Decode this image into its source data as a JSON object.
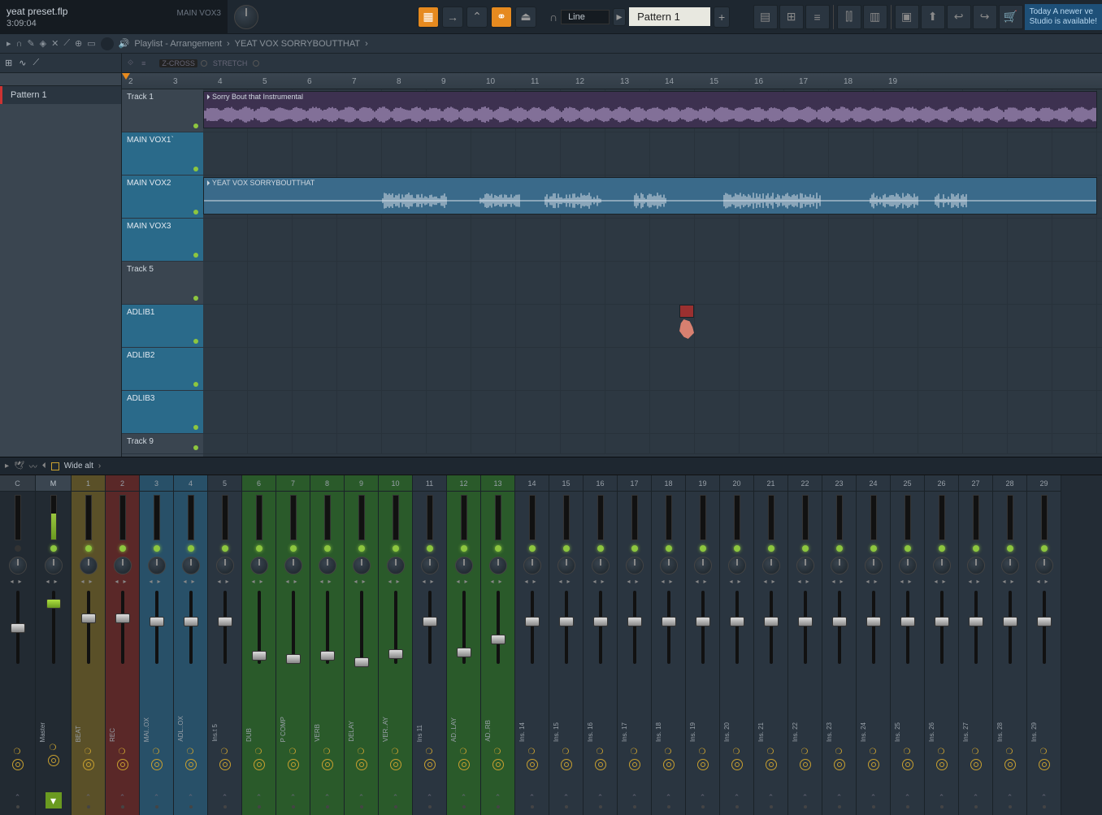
{
  "project": {
    "name": "yeat preset.flp",
    "time": "3:09:04",
    "channel": "MAIN VOX3"
  },
  "toolbar": {
    "snap_label": "Line",
    "pattern_label": "Pattern 1"
  },
  "update": {
    "today": "Today",
    "msg": "A newer ve",
    "msg2": "Studio is available!"
  },
  "breadcrumb": {
    "a": "Playlist - Arrangement",
    "b": "YEAT VOX SORRYBOUTTHAT"
  },
  "playlist_toolbar": {
    "zcross": "Z-CROSS",
    "stretch": "STRETCH"
  },
  "left_panel": {
    "pattern1": "Pattern 1"
  },
  "ruler_start": 2,
  "ruler_count": 18,
  "tracks": [
    {
      "label": "Track 1",
      "blue": false
    },
    {
      "label": "MAIN VOX1`",
      "blue": true
    },
    {
      "label": "MAIN VOX2",
      "blue": true
    },
    {
      "label": "MAIN VOX3",
      "blue": true
    },
    {
      "label": "Track 5",
      "blue": false
    },
    {
      "label": "ADLIB1",
      "blue": true
    },
    {
      "label": "ADLIB2",
      "blue": true
    },
    {
      "label": "ADLIB3",
      "blue": true
    },
    {
      "label": "Track 9",
      "blue": false
    }
  ],
  "clips": {
    "clip1": "Sorry Bout that Instrumental",
    "clip2": "YEAT VOX SORRYBOUTTHAT"
  },
  "mixer": {
    "layout": "Wide alt",
    "cols": [
      {
        "num": "C",
        "cls": "master-sec",
        "label": "",
        "led": false,
        "fader": 40
      },
      {
        "num": "M",
        "cls": "master-sec",
        "label": "Master",
        "led": true,
        "fader": 10,
        "master": true
      },
      {
        "num": "1",
        "cls": "yellow",
        "label": "BEAT",
        "led": true,
        "fader": 28
      },
      {
        "num": "2",
        "cls": "red",
        "label": "REC",
        "led": true,
        "fader": 28
      },
      {
        "num": "3",
        "cls": "blue",
        "label": "MAI..OX",
        "led": true,
        "fader": 32
      },
      {
        "num": "4",
        "cls": "blue",
        "label": "ADL..OX",
        "led": true,
        "fader": 32
      },
      {
        "num": "5",
        "cls": "",
        "label": "Ins.t 5",
        "led": true,
        "fader": 32
      },
      {
        "num": "6",
        "cls": "green",
        "label": "DUB",
        "led": true,
        "fader": 74
      },
      {
        "num": "7",
        "cls": "green",
        "label": "P COMP",
        "led": true,
        "fader": 78
      },
      {
        "num": "8",
        "cls": "green",
        "label": "VERB",
        "led": true,
        "fader": 74
      },
      {
        "num": "9",
        "cls": "green",
        "label": "DELAY",
        "led": true,
        "fader": 82
      },
      {
        "num": "10",
        "cls": "green",
        "label": "VER..AY",
        "led": true,
        "fader": 72
      },
      {
        "num": "11",
        "cls": "",
        "label": "Ins 11",
        "led": true,
        "fader": 32
      },
      {
        "num": "12",
        "cls": "green",
        "label": "AD..LAY",
        "led": true,
        "fader": 70
      },
      {
        "num": "13",
        "cls": "green",
        "label": "AD..RB",
        "led": true,
        "fader": 54
      },
      {
        "num": "14",
        "cls": "",
        "label": "Ins. 14",
        "led": true,
        "fader": 32
      },
      {
        "num": "15",
        "cls": "",
        "label": "Ins. 15",
        "led": true,
        "fader": 32
      },
      {
        "num": "16",
        "cls": "",
        "label": "Ins. 16",
        "led": true,
        "fader": 32
      },
      {
        "num": "17",
        "cls": "",
        "label": "Ins. 17",
        "led": true,
        "fader": 32
      },
      {
        "num": "18",
        "cls": "",
        "label": "Ins. 18",
        "led": true,
        "fader": 32
      },
      {
        "num": "19",
        "cls": "",
        "label": "Ins. 19",
        "led": true,
        "fader": 32
      },
      {
        "num": "20",
        "cls": "",
        "label": "Ins. 20",
        "led": true,
        "fader": 32
      },
      {
        "num": "21",
        "cls": "",
        "label": "Ins. 21",
        "led": true,
        "fader": 32
      },
      {
        "num": "22",
        "cls": "",
        "label": "Ins. 22",
        "led": true,
        "fader": 32
      },
      {
        "num": "23",
        "cls": "",
        "label": "Ins. 23",
        "led": true,
        "fader": 32
      },
      {
        "num": "24",
        "cls": "",
        "label": "Ins. 24",
        "led": true,
        "fader": 32
      },
      {
        "num": "25",
        "cls": "",
        "label": "Ins. 25",
        "led": true,
        "fader": 32
      },
      {
        "num": "26",
        "cls": "",
        "label": "Ins. 26",
        "led": true,
        "fader": 32
      },
      {
        "num": "27",
        "cls": "",
        "label": "Ins. 27",
        "led": true,
        "fader": 32
      },
      {
        "num": "28",
        "cls": "",
        "label": "Ins. 28",
        "led": true,
        "fader": 32
      },
      {
        "num": "29",
        "cls": "",
        "label": "Ins. 29",
        "led": true,
        "fader": 32
      }
    ]
  }
}
